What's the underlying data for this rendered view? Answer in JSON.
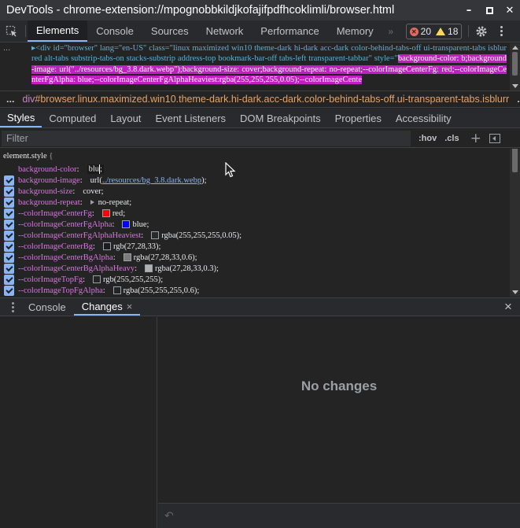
{
  "window": {
    "title": "DevTools - chrome-extension://mpognobbkildjkofajifpdfhcoklimli/browser.html",
    "controls": [
      "minimize-icon",
      "maximize-icon",
      "close-icon"
    ]
  },
  "main_tabs": [
    "Elements",
    "Console",
    "Sources",
    "Network",
    "Performance",
    "Memory"
  ],
  "main_tabs_active": "Elements",
  "issues": {
    "errors": "20",
    "warnings": "18"
  },
  "dom": {
    "dots": "...",
    "line_plain": "<div id=\"browser\" lang=\"en-US\" class=\"linux maximized win10 theme-dark hi-dark acc-dark color-behind-tabs-off ui-transparent-tabs isblurred alt-tabs substrip-tabs-on stacks-substrip address-top bookmark-bar-off tabs-left transparent-tabbar\" style=\"",
    "line_selected": "background-color: b;background-image: url(\"../resources/bg_3.8.dark.webp\");background-size: cover;background-repeat: no-repeat;--colorImageCenterFg: red;--colorImageCenterFgAlpha: blue;--colorImageCenterFgAlphaHeaviest:rgba(255,255,255,0.05);--colorImageCente"
  },
  "breadcrumb": {
    "lead": "...",
    "tag": "div",
    "node": "#browser.linux.maximized.win10.theme-dark.hi-dark.acc-dark.color-behind-tabs-off.ui-transparent-tabs.isblurr",
    "trail": "..."
  },
  "sub_tabs": [
    "Styles",
    "Computed",
    "Layout",
    "Event Listeners",
    "DOM Breakpoints",
    "Properties",
    "Accessibility"
  ],
  "sub_tabs_active": "Styles",
  "filter": {
    "placeholder": "Filter",
    "hov": ":hov",
    "cls": ".cls",
    "plus": "+"
  },
  "styles": {
    "selector": "element.style",
    "open_brace": "{",
    "properties": [
      {
        "name": "background-color",
        "value": "blu",
        "checked": false,
        "editing": true
      },
      {
        "name": "background-image",
        "value_prefix": "url(",
        "value_link": "../resources/bg_3.8.dark.webp",
        "value_suffix": ");",
        "checked": true
      },
      {
        "name": "background-size",
        "value": "cover;",
        "checked": true
      },
      {
        "name": "background-repeat",
        "value": "no-repeat;",
        "checked": true,
        "expand": true
      },
      {
        "name": "--colorImageCenterFg",
        "value": "red;",
        "checked": true,
        "swatch": "#ff0000"
      },
      {
        "name": "--colorImageCenterFgAlpha",
        "value": "blue;",
        "checked": true,
        "swatch": "#0000ff"
      },
      {
        "name": "--colorImageCenterFgAlphaHeaviest",
        "value": "rgba(255,255,255,0.05);",
        "checked": true,
        "swatch": "#2a2a2a"
      },
      {
        "name": "--colorImageCenterBg",
        "value": "rgb(27,28,33);",
        "checked": true,
        "swatch": "#1b1c21"
      },
      {
        "name": "--colorImageCenterBgAlpha",
        "value": "rgba(27,28,33,0.6);",
        "checked": true,
        "swatch": "#7b7b7b"
      },
      {
        "name": "--colorImageCenterBgAlphaHeavy",
        "value": "rgba(27,28,33,0.3);",
        "checked": true,
        "swatch": "#b0b0b0"
      },
      {
        "name": "--colorImageTopFg",
        "value": "rgb(255,255,255);",
        "checked": true,
        "swatch": "#242424"
      },
      {
        "name": "--colorImageTopFgAlpha",
        "value": "rgba(255,255,255,0.6);",
        "checked": true,
        "swatch": "#242424"
      }
    ]
  },
  "drawer": {
    "tabs": [
      "Console",
      "Changes"
    ],
    "active": "Changes",
    "tab_close": "×",
    "close": "×",
    "empty_message": "No changes",
    "revert_icon": "revert-icon"
  },
  "colors": {
    "accent": "#8ab4f8",
    "property_name": "#e36eec",
    "dom_selection": "#c31dc3",
    "breadcrumb_node": "#e8a264"
  }
}
